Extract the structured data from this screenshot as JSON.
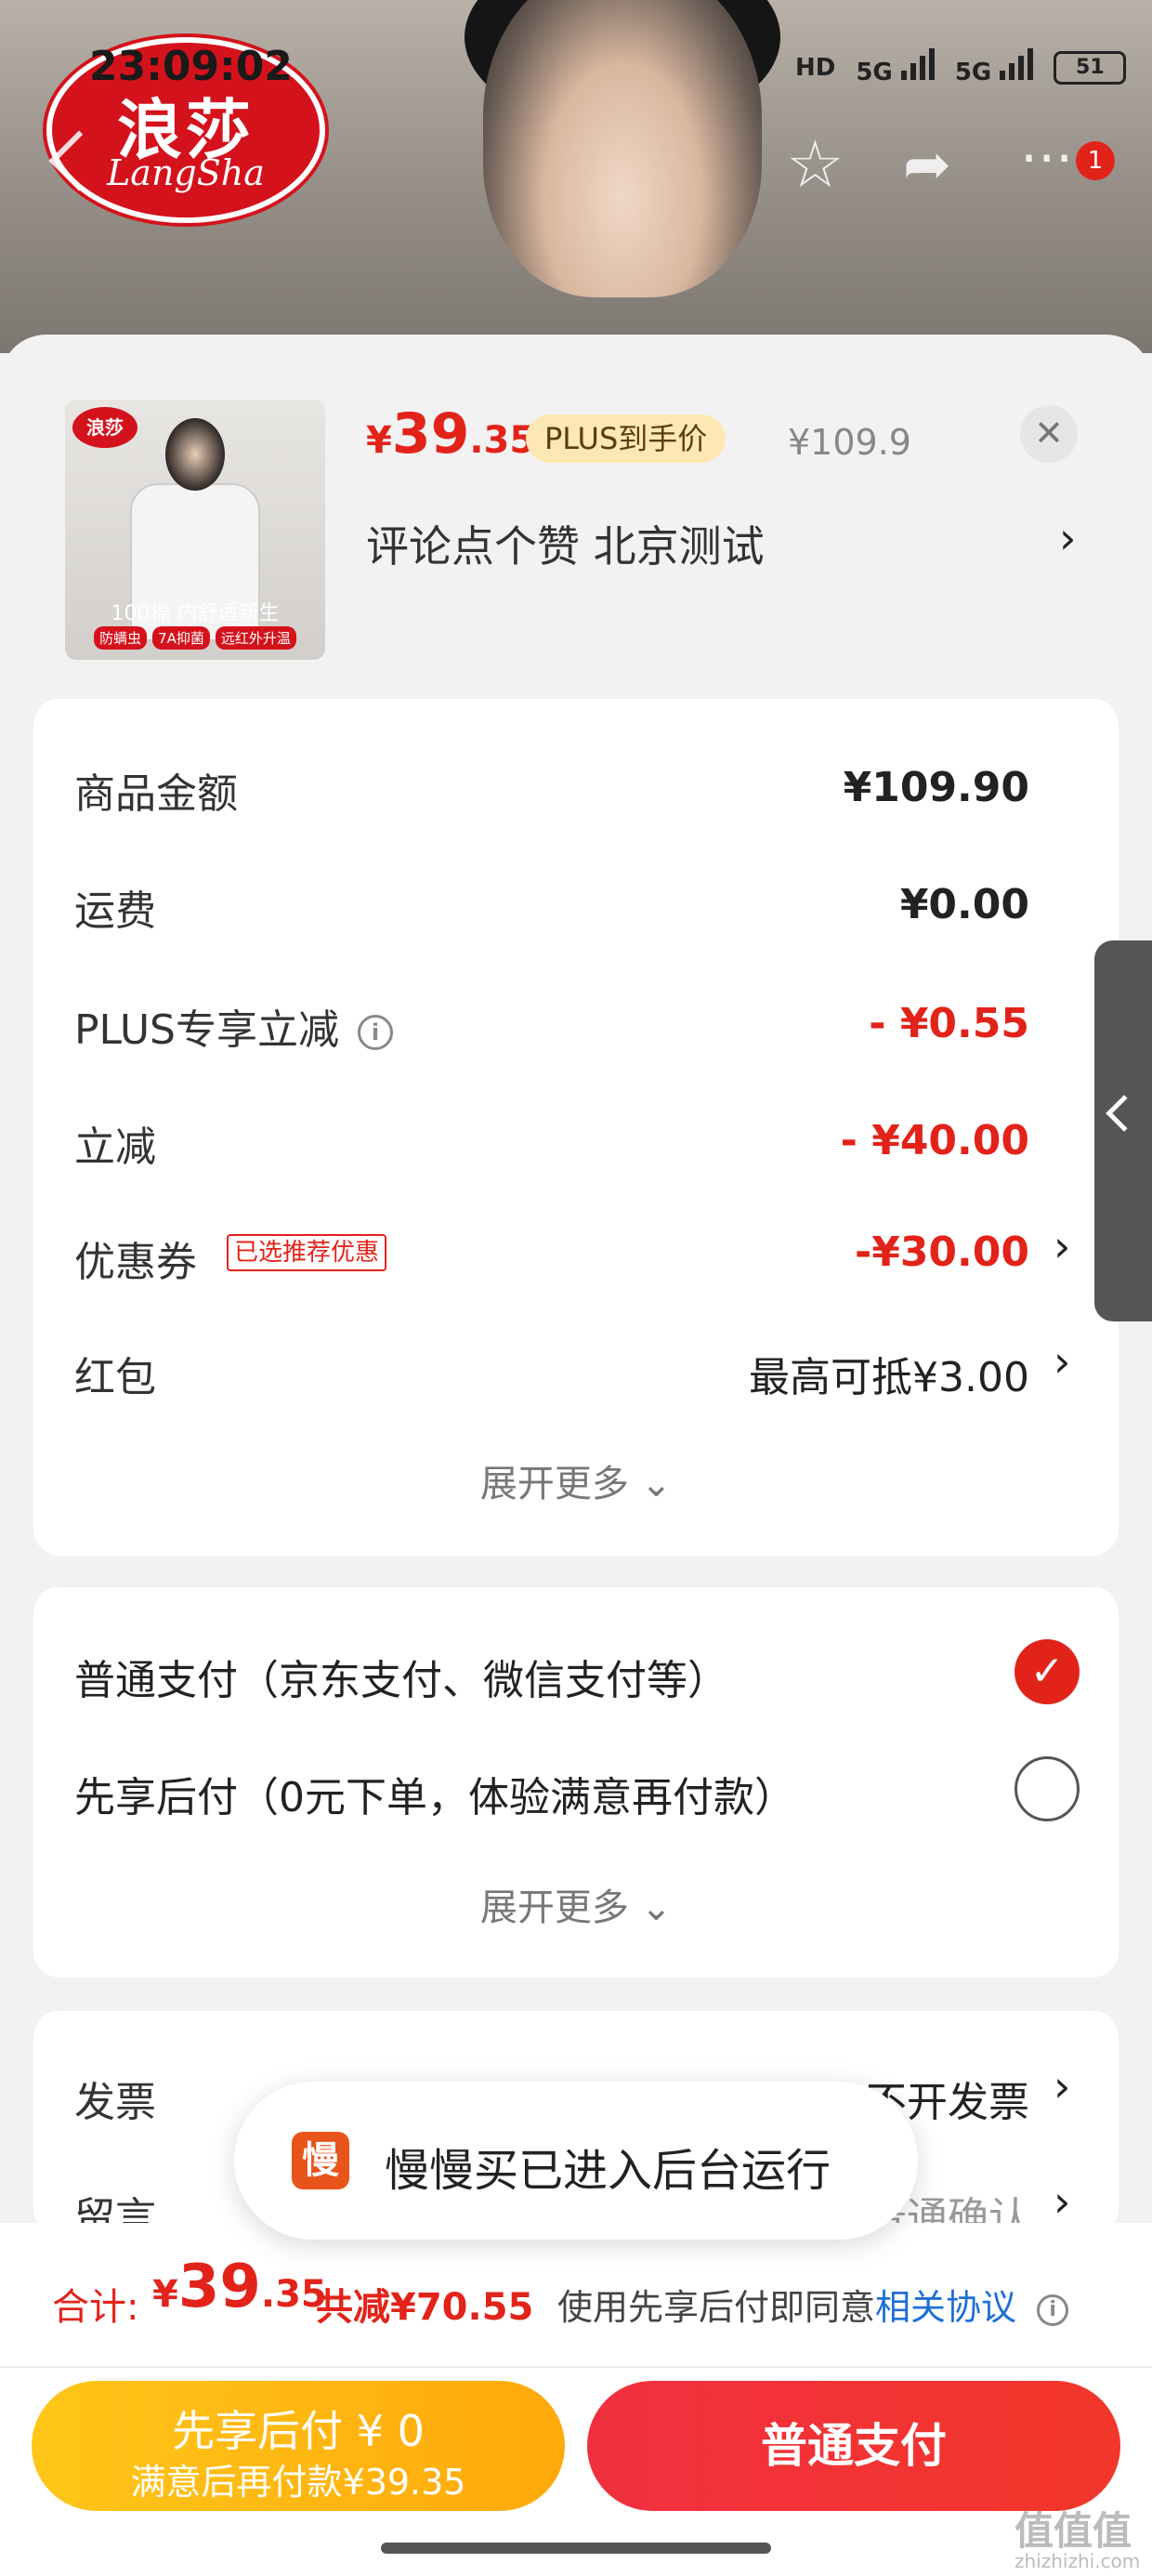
{
  "status_bar": {
    "time": "23:09:02",
    "hd": "HD",
    "net1": "5G",
    "net2": "5G",
    "battery": "51"
  },
  "brand_logo": {
    "main": "浪莎",
    "sub": "LangSha"
  },
  "nav": {
    "badge": "1"
  },
  "product": {
    "logo": "浪莎",
    "image_caption": "100棉 内舒适新生",
    "image_tags": [
      "防螨虫",
      "7A抑菌",
      "远红外升温"
    ],
    "price_symbol": "¥",
    "price_int": "39",
    "price_dec": ".35",
    "plus_label": "PLUS到手价",
    "original_price": "¥109.9",
    "spec": "评论点个赞  北京测试"
  },
  "summary": {
    "rows": [
      {
        "label": "商品金额",
        "value": "¥109.90"
      },
      {
        "label": "运费",
        "value": "¥0.00"
      },
      {
        "label": "PLUS专享立减",
        "value": "- ¥0.55"
      },
      {
        "label": "立减",
        "value": "- ¥40.00"
      },
      {
        "label": "优惠券",
        "value": "-¥30.00",
        "tag": "已选推荐优惠"
      },
      {
        "label": "红包",
        "value": "最高可抵¥3.00"
      }
    ],
    "expand": "展开更多"
  },
  "payment": {
    "options": [
      {
        "label": "普通支付（京东支付、微信支付等）",
        "selected": true
      },
      {
        "label": "先享后付（0元下单，体验满意再付款）",
        "selected": false
      }
    ],
    "expand": "展开更多"
  },
  "extra": {
    "invoice_label": "发票",
    "invoice_value": "不开发票",
    "message_label": "留言",
    "message_value": "普通确认"
  },
  "toast": {
    "icon": "慢",
    "text": "慢慢买已进入后台运行"
  },
  "footer": {
    "total_label": "合计:",
    "total_symbol": "¥",
    "total_int": "39",
    "total_dec": ".35",
    "total_reduce": "共减¥70.55",
    "agree_text": "使用先享后付即同意",
    "agree_link": "相关协议",
    "btn_after_line1": "先享后付 ¥ 0",
    "btn_after_line2": "满意后再付款¥39.35",
    "btn_pay": "普通支付"
  },
  "watermark": {
    "main": "值值值",
    "sub": "zhizhizhi.com"
  },
  "colors": {
    "accent_red": "#e2231a",
    "plus_bg": "#fde8b4",
    "after_pay_yellow": "#ffb313",
    "link_blue": "#1e6fd6"
  }
}
